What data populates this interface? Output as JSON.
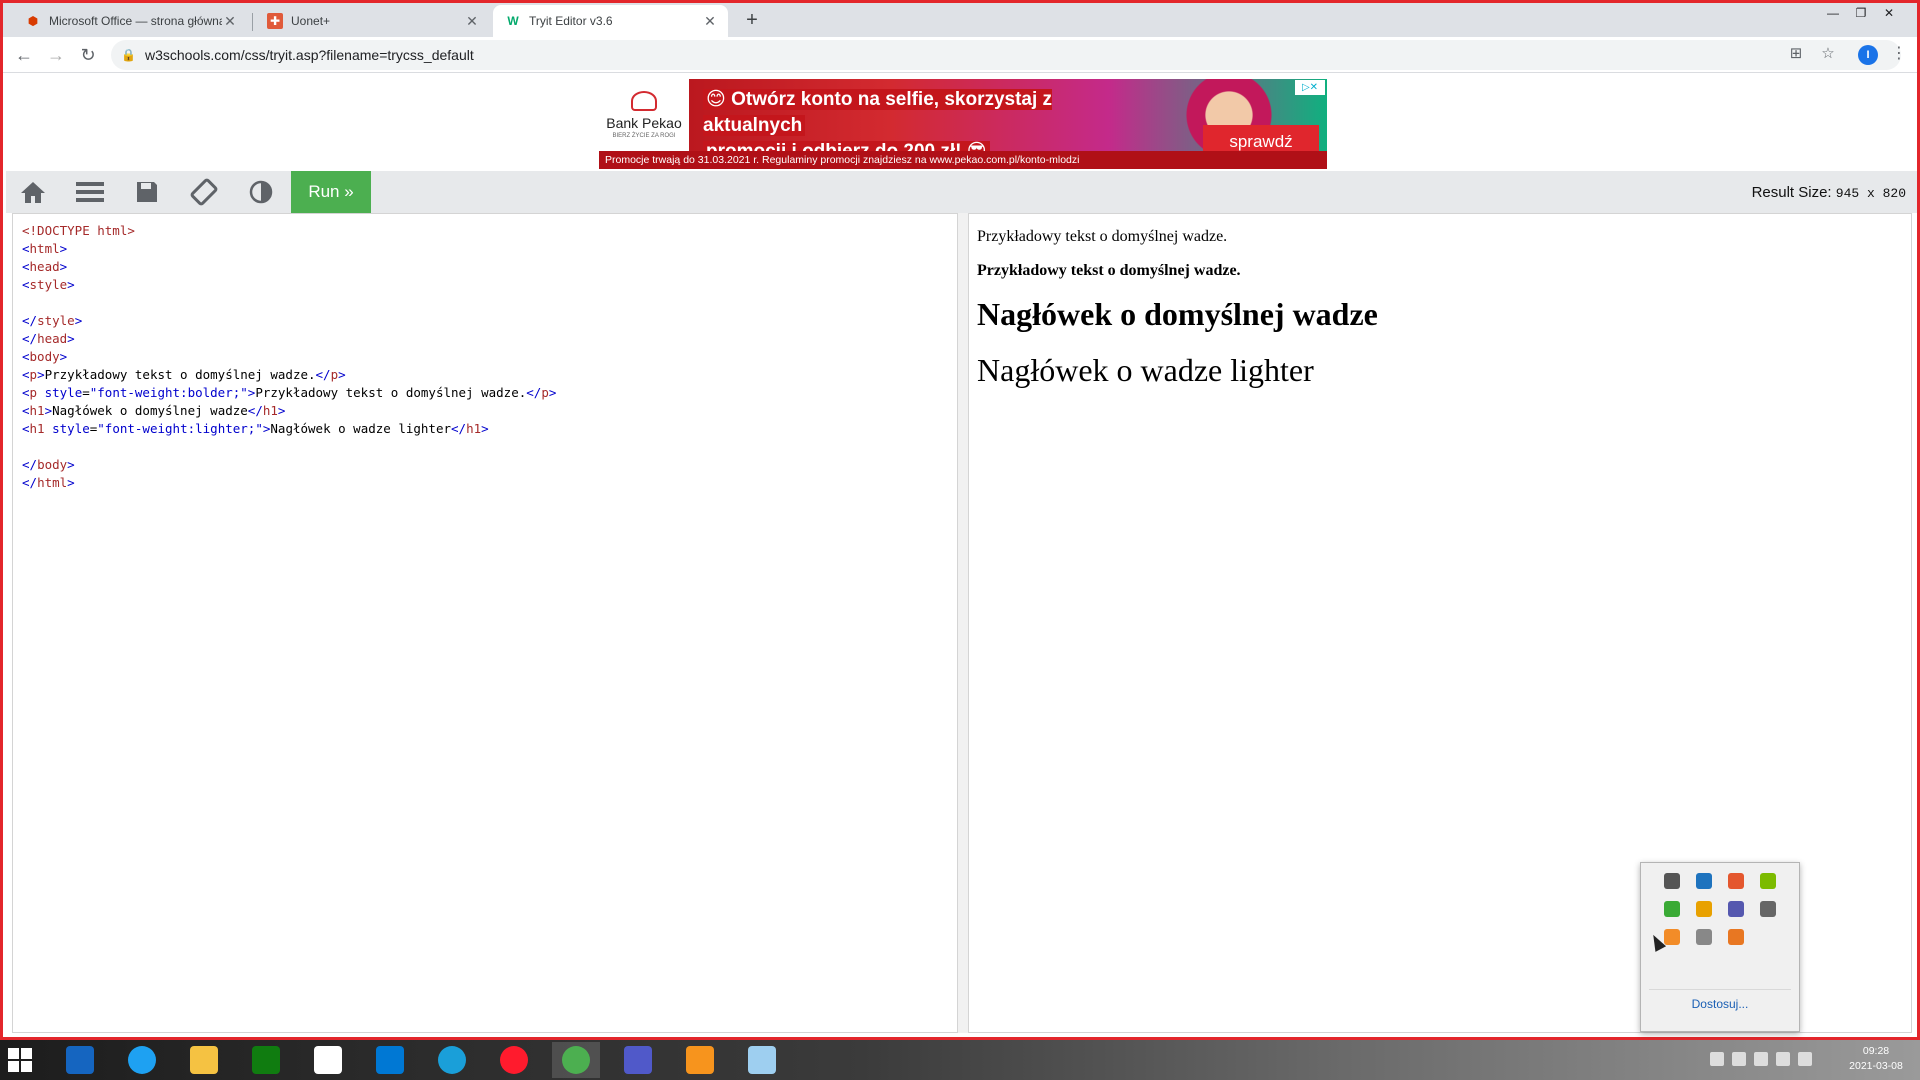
{
  "browser": {
    "tabs": [
      {
        "title": "Microsoft Office — strona główna",
        "favicon": "office-icon",
        "active": false
      },
      {
        "title": "Uonet+",
        "favicon": "uonet-icon",
        "active": false
      },
      {
        "title": "Tryit Editor v3.6",
        "favicon": "w3schools-icon",
        "active": true
      }
    ],
    "new_tab": "+",
    "url": "w3schools.com/css/tryit.asp?filename=trycss_default",
    "profile_initial": "I"
  },
  "ad": {
    "bank_name": "Bank Pekao",
    "bank_slogan": "BIERZ ŻYCIE ZA ROGI",
    "headline_line1": "😊 Otwórz konto na selfie, skorzystaj z aktualnych",
    "headline_line2": "promocji i odbierz do 200 zł! 😎",
    "cta": "sprawdź",
    "footer": "Promocje trwają do 31.03.2021 r. Regulaminy promocji znajdziesz na www.pekao.com.pl/konto-mlodzi",
    "adchoices": "▷✕"
  },
  "tryit": {
    "run_label": "Run »",
    "result_size_label": "Result Size:",
    "result_size_value": "945 x 820"
  },
  "code_lines": [
    "<!DOCTYPE html>",
    "<html>",
    "<head>",
    "<style>",
    "",
    "</style>",
    "</head>",
    "<body>",
    "<p>Przykładowy tekst o domyślnej wadze.</p>",
    "<p style=\"font-weight:bolder;\">Przykładowy tekst o domyślnej wadze.</p>",
    "<h1>Nagłówek o domyślnej wadze</h1>",
    "<h1 style=\"font-weight:lighter;\">Nagłówek o wadze lighter</h1>",
    "",
    "</body>",
    "</html>"
  ],
  "result": {
    "p1": "Przykładowy tekst o domyślnej wadze.",
    "p2": "Przykładowy tekst o domyślnej wadze.",
    "h1_default": "Nagłówek o domyślnej wadze",
    "h1_lighter": "Nagłówek o wadze lighter"
  },
  "tray_popup": {
    "customize": "Dostosuj...",
    "icon_colors": [
      "#555",
      "#1e73be",
      "#e4572e",
      "#7cbb00",
      "#3aaa35",
      "#e8a100",
      "#5558af",
      "#666",
      "#f28c28",
      "#888",
      "#e87722"
    ]
  },
  "taskbar": {
    "time": "09:28",
    "date": "2021-03-08",
    "apps": [
      {
        "name": "lenovo-icon",
        "color": "#1565c0"
      },
      {
        "name": "internet-explorer-icon",
        "color": "#1ea1f2"
      },
      {
        "name": "file-explorer-icon",
        "color": "#f5c242"
      },
      {
        "name": "store-icon",
        "color": "#107c10"
      },
      {
        "name": "home-icon",
        "color": "#ffffff"
      },
      {
        "name": "mail-icon",
        "color": "#0078d4"
      },
      {
        "name": "edge-icon",
        "color": "#1a9fd9"
      },
      {
        "name": "opera-icon",
        "color": "#ff1b2d"
      },
      {
        "name": "chrome-icon",
        "color": "#4caf50"
      },
      {
        "name": "teams-icon",
        "color": "#5059c9"
      },
      {
        "name": "pdf-icon",
        "color": "#f7941d"
      },
      {
        "name": "notes-icon",
        "color": "#9ecff0"
      }
    ]
  }
}
